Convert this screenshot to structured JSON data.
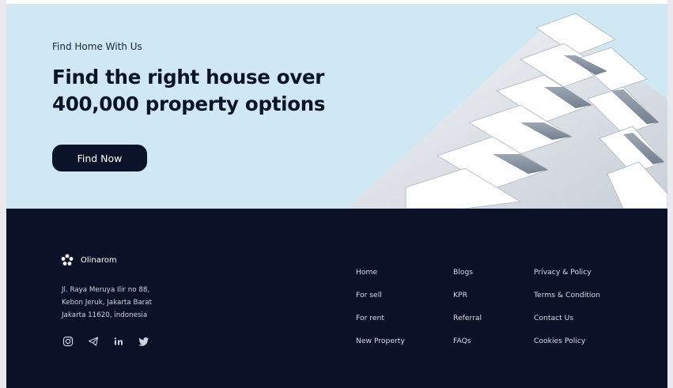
{
  "hero": {
    "eyebrow": "Find Home With Us",
    "headline_line1": "Find the right house over",
    "headline_line2": "400,000 property options",
    "cta_label": "Find Now"
  },
  "footer": {
    "brand_name": "Olinarom",
    "address_line1": "Jl. Raya Meruya Ilir no 88,",
    "address_line2": "Kebon Jeruk, Jakarta Barat",
    "address_line3": "Jakarta 11620, indonesia",
    "social_icons": [
      "instagram-icon",
      "telegram-icon",
      "linkedin-icon",
      "twitter-icon"
    ],
    "col1": [
      "Home",
      "For sell",
      "For rent",
      "New Property"
    ],
    "col2": [
      "Blogs",
      "KPR",
      "Referral",
      "FAQs"
    ],
    "col3": [
      "Privacy & Policy",
      "Terms & Condition",
      "Contact Us",
      "Cookies Policy"
    ]
  },
  "colors": {
    "hero_bg": "#cfe8f3",
    "footer_bg": "#0b1127",
    "cta_bg": "#0b1328"
  }
}
